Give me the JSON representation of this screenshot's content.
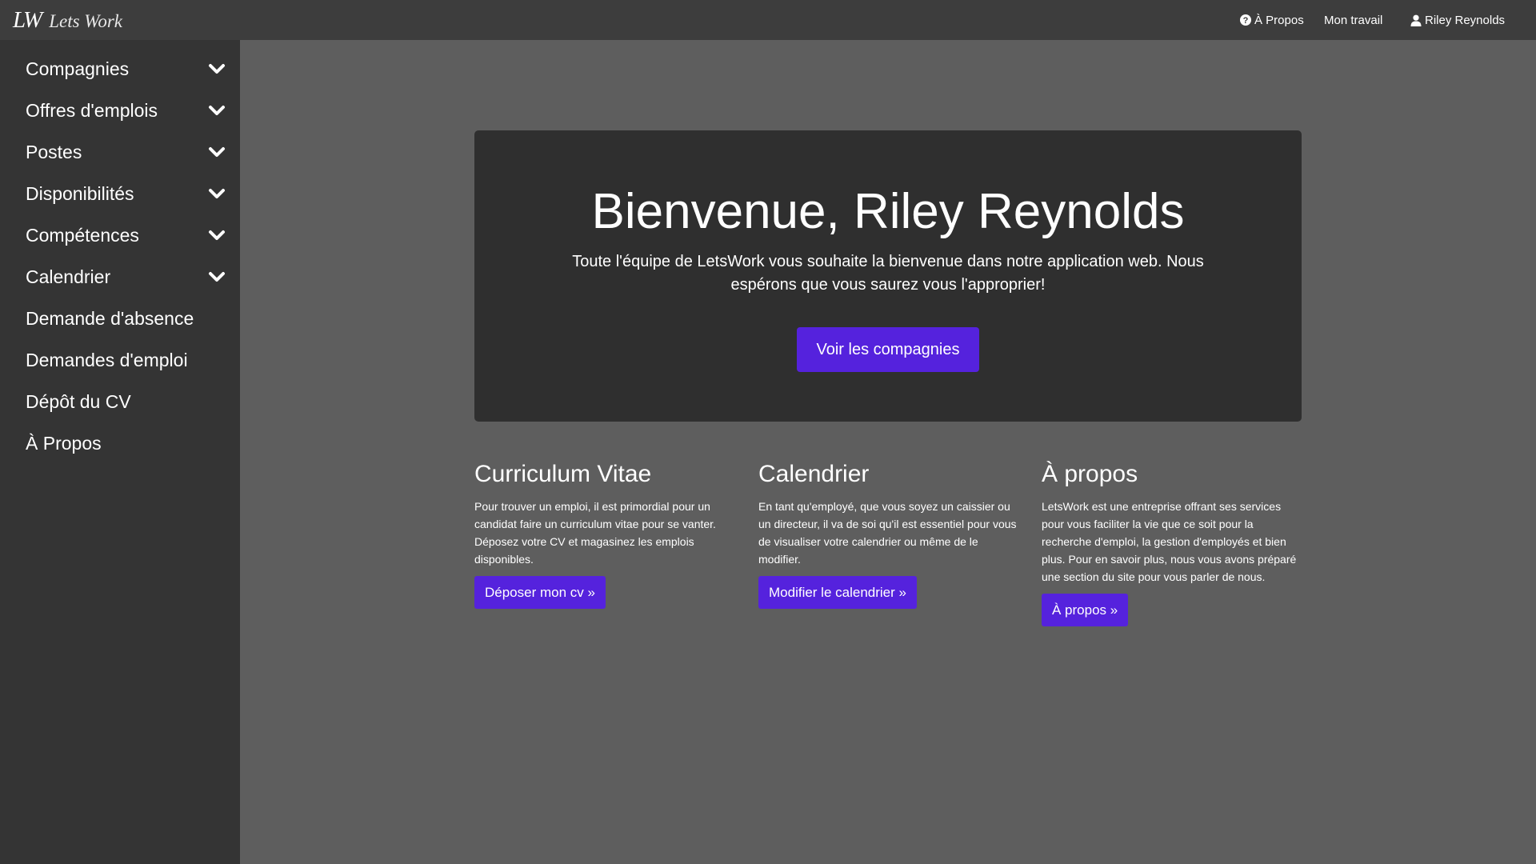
{
  "header": {
    "brand_mark": "LW",
    "brand_text": "Lets Work",
    "nav": {
      "about": "À Propos",
      "work": "Mon travail",
      "user": "Riley Reynolds"
    }
  },
  "sidebar": {
    "items": [
      {
        "label": "Compagnies",
        "has_chevron": true
      },
      {
        "label": "Offres d'emplois",
        "has_chevron": true
      },
      {
        "label": "Postes",
        "has_chevron": true
      },
      {
        "label": "Disponibilités",
        "has_chevron": true
      },
      {
        "label": "Compétences",
        "has_chevron": true
      },
      {
        "label": "Calendrier",
        "has_chevron": true
      },
      {
        "label": "Demande d'absence",
        "has_chevron": false
      },
      {
        "label": "Demandes d'emploi",
        "has_chevron": false
      },
      {
        "label": "Dépôt du CV",
        "has_chevron": false
      },
      {
        "label": "À Propos",
        "has_chevron": false
      }
    ]
  },
  "hero": {
    "title": "Bienvenue, Riley Reynolds",
    "text": "Toute l'équipe de LetsWork vous souhaite la bienvenue dans notre application web. Nous espérons que vous saurez vous l'approprier!",
    "button": "Voir les compagnies"
  },
  "cards": [
    {
      "title": "Curriculum Vitae",
      "text": "Pour trouver un emploi, il est primordial pour un candidat faire un curriculum vitae pour se vanter. Déposez votre CV et magasinez les emplois disponibles.",
      "button": "Déposer mon cv »"
    },
    {
      "title": "Calendrier",
      "text": "En tant qu'employé, que vous soyez un caissier ou un directeur, il va de soi qu'il est essentiel pour vous de visualiser votre calendrier ou même de le modifier.",
      "button": "Modifier le calendrier »"
    },
    {
      "title": "À propos",
      "text": "LetsWork est une entreprise offrant ses services pour vous faciliter la vie que ce soit pour la recherche d'emploi, la gestion d'employés et bien plus. Pour en savoir plus, nous vous avons préparé une section du site pour vous parler de nous.",
      "button": "À propos »"
    }
  ],
  "colors": {
    "topbar": "#3d3d3d",
    "sidebar": "#343434",
    "background": "#5e5e5e",
    "jumbotron": "#2f2f2f",
    "accent": "#5522dd"
  },
  "icons": {
    "about": "question-circle-icon",
    "user": "user-icon",
    "chevron": "chevron-down-icon"
  }
}
